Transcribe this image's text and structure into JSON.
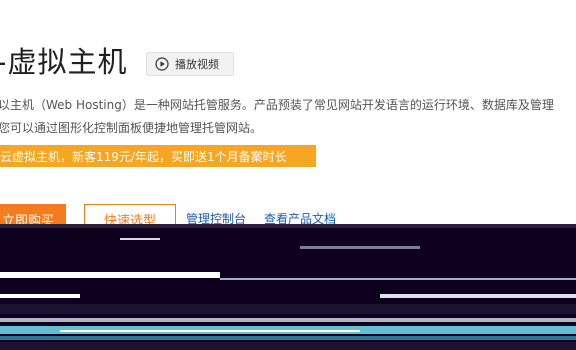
{
  "header": {
    "title": "-虚拟主机",
    "video_button_label": "播放视频"
  },
  "description": {
    "line1": "以主机（Web Hosting）是一种网站托管服务。产品预装了常见网站开发语言的运行环境、数据库及管理",
    "line2": "您可以通过图形化控制面板便捷地管理托管网站。"
  },
  "promo": {
    "text": "云虚拟主机，新客119元/年起，买即送1个月备案时长"
  },
  "actions": {
    "buy_label": "立即购买",
    "quick_select_label": "快速选型",
    "console_link": "管理控制台",
    "docs_link": "查看产品文档"
  },
  "colors": {
    "accent_orange": "#f47c20",
    "promo_yellow": "#f5a623",
    "link_blue": "#1a5fb4",
    "glitch_dark": "#0f0020"
  },
  "icons": {
    "video": "play-circle-icon"
  }
}
